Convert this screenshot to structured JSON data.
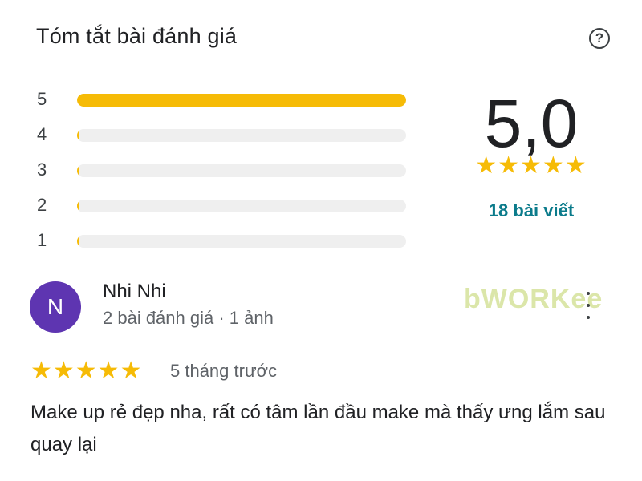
{
  "summary": {
    "title": "Tóm tắt bài đánh giá",
    "help_icon": "help-circle-icon",
    "average": "5,0",
    "average_stars": "★★★★★",
    "count_text": "18 bài viết",
    "accent_color": "#f6bb06",
    "link_color": "#0b7b8b"
  },
  "distribution": [
    {
      "label": "5",
      "fraction": 1.0
    },
    {
      "label": "4",
      "fraction": 0.0
    },
    {
      "label": "3",
      "fraction": 0.0
    },
    {
      "label": "2",
      "fraction": 0.0
    },
    {
      "label": "1",
      "fraction": 0.0
    }
  ],
  "review": {
    "avatar_letter": "N",
    "avatar_color": "#5e35b1",
    "name": "Nhi Nhi",
    "meta": "2 bài đánh giá · 1 ảnh",
    "stars": "★★★★★",
    "time": "5 tháng trước",
    "text": "Make up rẻ đẹp nha, rất có tâm lần đầu make mà thấy ưng lắm sau quay lại",
    "more_icon": "more-vert-icon"
  },
  "watermark": "bWORKee"
}
